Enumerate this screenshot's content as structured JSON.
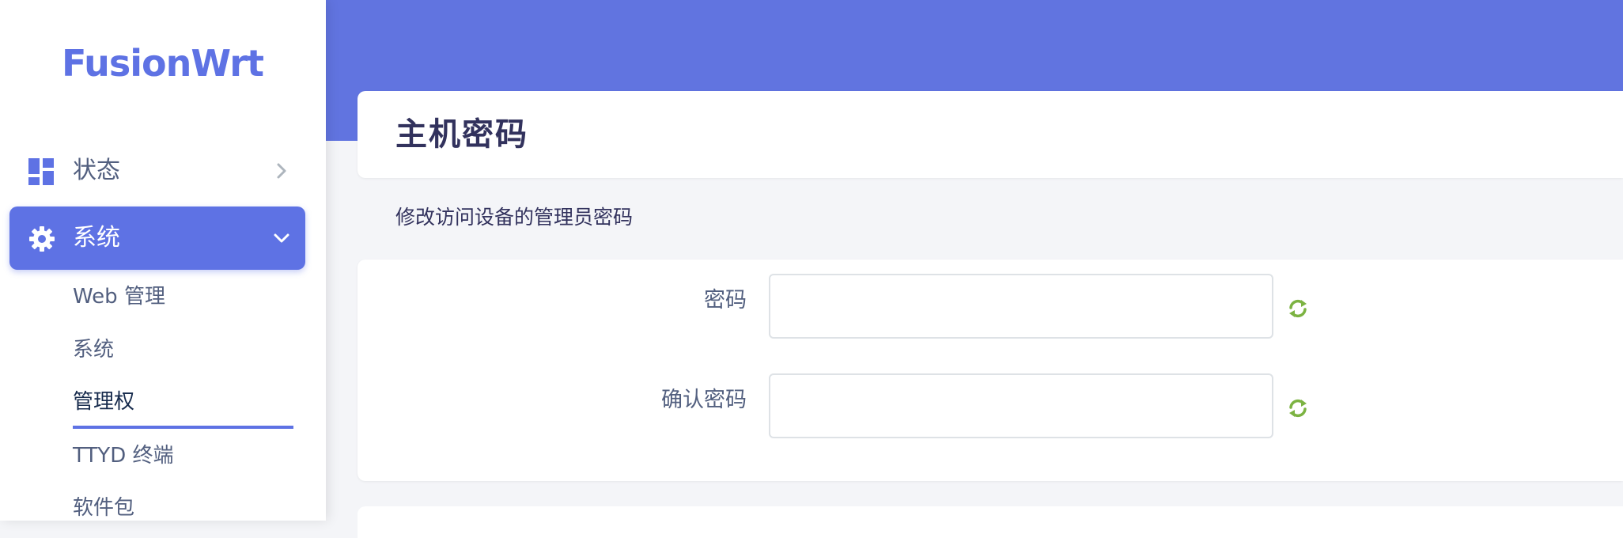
{
  "brand": {
    "logo_text": "FusionWrt",
    "accent_color": "#5e72e4"
  },
  "sidebar": {
    "menus": [
      {
        "label": "状态",
        "icon": "dashboard-icon",
        "expanded": false
      },
      {
        "label": "系统",
        "icon": "gear-icon",
        "expanded": true
      }
    ],
    "submenu": [
      {
        "label": "Web 管理",
        "active": false
      },
      {
        "label": "系统",
        "active": false
      },
      {
        "label": "管理权",
        "active": true
      },
      {
        "label": "TTYD 终端",
        "active": false
      },
      {
        "label": "软件包",
        "active": false
      }
    ]
  },
  "main": {
    "title": "主机密码",
    "description": "修改访问设备的管理员密码",
    "fields": [
      {
        "label": "密码",
        "value": "",
        "icon": "refresh-icon"
      },
      {
        "label": "确认密码",
        "value": "",
        "icon": "refresh-icon"
      }
    ]
  }
}
